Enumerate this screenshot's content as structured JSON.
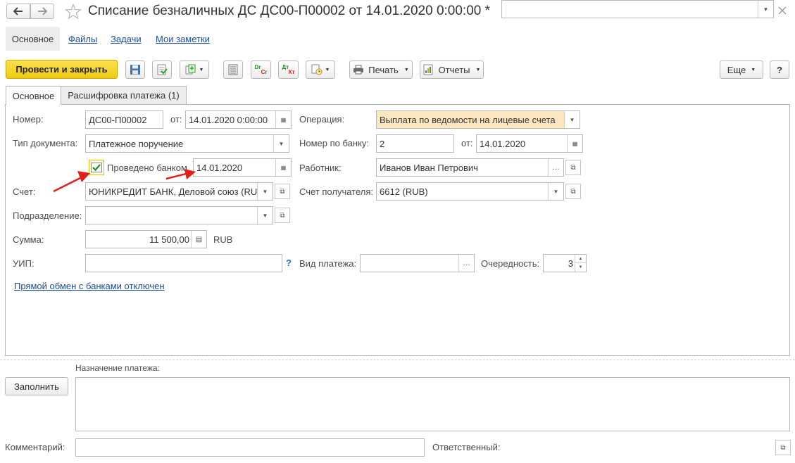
{
  "title": "Списание безналичных ДС ДС00-П00002 от 14.01.2020 0:00:00 *",
  "nav_tabs": [
    "Основное",
    "Файлы",
    "Задачи",
    "Мои заметки"
  ],
  "toolbar": {
    "post_close": "Провести и закрыть",
    "print": "Печать",
    "reports": "Отчеты",
    "more": "Еще",
    "help": "?",
    "dt_icon": "Dr Cr",
    "dk_icon": "Дт Кт"
  },
  "form_tabs": [
    "Основное",
    "Расшифровка платежа (1)"
  ],
  "fields": {
    "number_label": "Номер:",
    "number_value": "ДС00-П00002",
    "from_label": "от:",
    "date_value": "14.01.2020  0:00:00",
    "doc_type_label": "Тип документа:",
    "doc_type_value": "Платежное поручение",
    "bank_posted_label": "Проведено банком",
    "bank_posted_date": "14.01.2020",
    "account_label": "Счет:",
    "account_value": "ЮНИКРЕДИТ БАНК, Деловой союз (RU",
    "division_label": "Подразделение:",
    "division_value": "",
    "amount_label": "Сумма:",
    "amount_value": "11 500,00",
    "currency": "RUB",
    "uip_label": "УИП:",
    "uip_value": "",
    "uip_help": "?",
    "operation_label": "Операция:",
    "operation_value": "Выплата по ведомости на лицевые счета",
    "bank_number_label": "Номер по банку:",
    "bank_number_value": "2",
    "bank_date_label": "от:",
    "bank_date_value": "14.01.2020",
    "employee_label": "Работник:",
    "employee_value": "Иванов Иван Петрович",
    "recipient_account_label": "Счет получателя:",
    "recipient_account_value": "6612 (RUB)",
    "payment_type_label": "Вид платежа:",
    "payment_type_value": "",
    "priority_label": "Очередность:",
    "priority_value": "3",
    "bank_link": "Прямой обмен с банками отключен"
  },
  "purpose": {
    "label": "Назначение платежа:",
    "fill_button": "Заполнить",
    "value": ""
  },
  "footer": {
    "comment_label": "Комментарий:",
    "comment_value": "",
    "responsible_label": "Ответственный:",
    "responsible_value": ""
  },
  "colors": {
    "primary_button": "#f5d31b",
    "operation_bg": "#fbe6bf",
    "annotation_arrow": "#e0201b",
    "link": "#1a4d8f"
  }
}
